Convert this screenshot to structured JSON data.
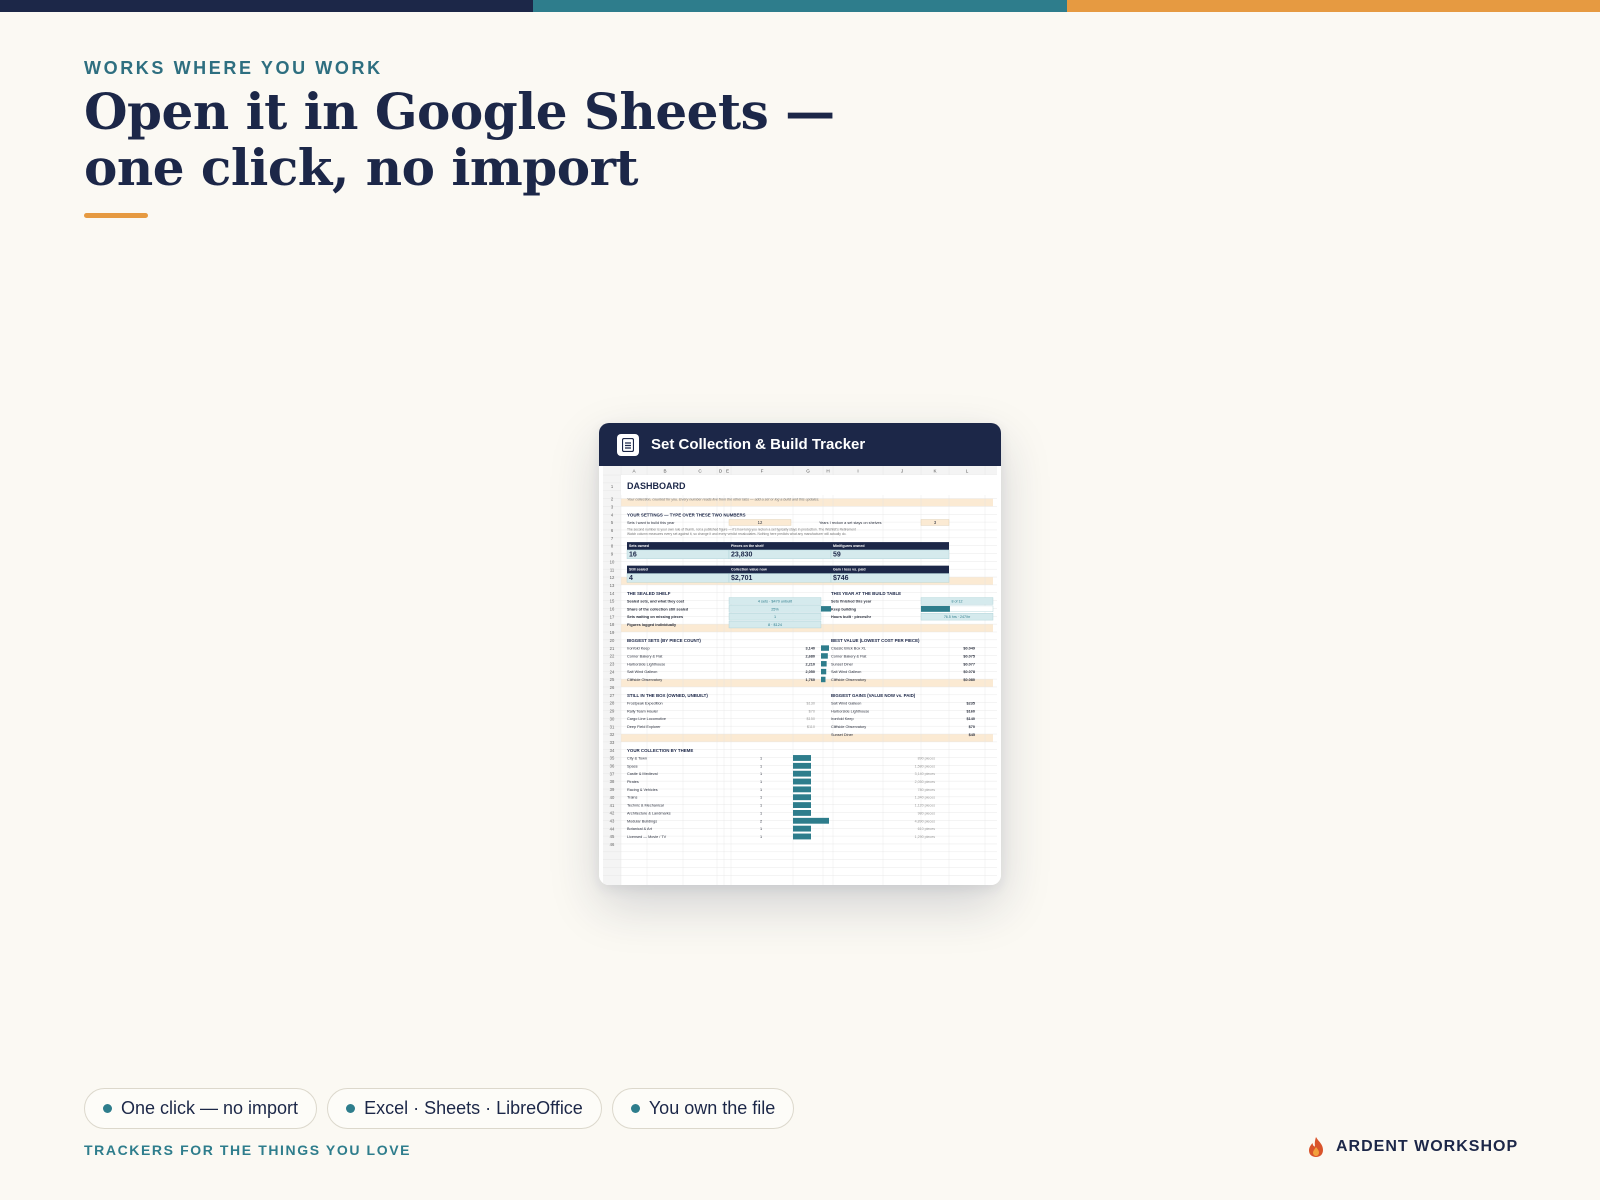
{
  "colors": {
    "navy": "#1c2748",
    "teal": "#2e7d8c",
    "orange": "#e69a41",
    "cream": "#fbf9f3"
  },
  "eyebrow": "WORKS WHERE YOU WORK",
  "headline": {
    "line1": "Open it in Google Sheets —",
    "line2": "one click, no import"
  },
  "preview": {
    "title": "Set Collection & Build Tracker",
    "icon": "sheet-icon",
    "columns": [
      "A",
      "B",
      "C",
      "D",
      "E",
      "F",
      "G",
      "H",
      "I",
      "J",
      "K",
      "L"
    ],
    "dashboard_title": "DASHBOARD",
    "intro": "Your collection, counted for you. Every number reads live from the other tabs — add a set or log a build and this updates.",
    "settings_header": "YOUR SETTINGS — TYPE OVER THESE TWO NUMBERS",
    "settings": [
      {
        "label": "Sets I want to build this year",
        "value": "12"
      },
      {
        "label": "Years I reckon a set stays on shelves",
        "value": "3"
      }
    ],
    "settings_note": "The second number is your own rule of thumb, not a published figure — it's how long you reckon a set typically stays in production. The Wishlist's Retirement Watch column measures every set against it, so change it and every verdict recalculates. Nothing here predicts what any manufacturer will actually do.",
    "kpis_row1": [
      {
        "label": "Sets owned",
        "value": "16"
      },
      {
        "label": "Pieces on the shelf",
        "value": "23,830"
      },
      {
        "label": "Minifigures owned",
        "value": "59"
      }
    ],
    "kpis_row2": [
      {
        "label": "Still sealed",
        "value": "4"
      },
      {
        "label": "Collection value now",
        "value": "$2,701"
      },
      {
        "label": "Gain / loss vs. paid",
        "value": "$746"
      }
    ],
    "sealed_header": "THE SEALED SHELF",
    "sealed": [
      {
        "label": "Sealed sets, and what they cost",
        "value": "4 sets · $470 unbuilt"
      },
      {
        "label": "Share of the collection still sealed",
        "value": "25%",
        "fraction": 0.25
      },
      {
        "label": "Sets waiting on missing pieces",
        "value": "1"
      },
      {
        "label": "Figures logged individually",
        "value": "8 · $124"
      }
    ],
    "build_header": "THIS YEAR AT THE BUILD TABLE",
    "build": [
      {
        "label": "Sets finished this year",
        "value": "8 of 12"
      },
      {
        "label": "Keep building",
        "value": "",
        "fraction": 0.67
      },
      {
        "label": "Hours built · pieces/hr",
        "value": "76.5 hrs · 247/hr"
      }
    ],
    "biggest_header": "BIGGEST SETS (BY PIECE COUNT)",
    "biggest": [
      {
        "name": "Ironfold Keep",
        "value": "3,140"
      },
      {
        "name": "Corner Bakery & Flat",
        "value": "2,680"
      },
      {
        "name": "Harborside Lighthouse",
        "value": "2,210"
      },
      {
        "name": "Salt Wind Galleon",
        "value": "2,050"
      },
      {
        "name": "Cliffside Observatory",
        "value": "1,760"
      }
    ],
    "bestvalue_header": "BEST VALUE (LOWEST COST PER PIECE)",
    "bestvalue": [
      {
        "name": "Classic Brick Box XL",
        "value": "$0.049"
      },
      {
        "name": "Corner Bakery & Flat",
        "value": "$0.075"
      },
      {
        "name": "Sunset Diner",
        "value": "$0.077"
      },
      {
        "name": "Salt Wind Galleon",
        "value": "$0.078"
      },
      {
        "name": "Cliffside Observatory",
        "value": "$0.080"
      }
    ],
    "inbox_header": "STILL IN THE BOX (OWNED, UNBUILT)",
    "inbox": [
      {
        "name": "Frostpeak Expedition",
        "value": "$130"
      },
      {
        "name": "Rally Team Hauler",
        "value": "$70"
      },
      {
        "name": "Cargo Line Locomotive",
        "value": "$150"
      },
      {
        "name": "Deep Field Explorer",
        "value": "$110"
      }
    ],
    "gains_header": "BIGGEST GAINS (VALUE NOW vs. PAID)",
    "gains": [
      {
        "name": "Salt Wind Galleon",
        "value": "$235"
      },
      {
        "name": "Harborside Lighthouse",
        "value": "$160"
      },
      {
        "name": "Ironfold Keep",
        "value": "$140"
      },
      {
        "name": "Cliffside Observatory",
        "value": "$70"
      },
      {
        "name": "Sunset Diner",
        "value": "$45"
      }
    ],
    "theme_header": "YOUR COLLECTION BY THEME",
    "themes": [
      {
        "name": "City & Town",
        "count": 1,
        "pieces": "890 pieces"
      },
      {
        "name": "Space",
        "count": 1,
        "pieces": "1,580 pieces"
      },
      {
        "name": "Castle & Medieval",
        "count": 1,
        "pieces": "3,140 pieces"
      },
      {
        "name": "Pirates",
        "count": 1,
        "pieces": "2,050 pieces"
      },
      {
        "name": "Racing & Vehicles",
        "count": 1,
        "pieces": "780 pieces"
      },
      {
        "name": "Trains",
        "count": 1,
        "pieces": "1,340 pieces"
      },
      {
        "name": "Technic & Mechanical",
        "count": 1,
        "pieces": "1,120 pieces"
      },
      {
        "name": "Architecture & Landmarks",
        "count": 1,
        "pieces": "980 pieces"
      },
      {
        "name": "Modular Buildings",
        "count": 2,
        "pieces": "4,890 pieces"
      },
      {
        "name": "Botanical & Art",
        "count": 1,
        "pieces": "610 pieces"
      },
      {
        "name": "Licensed — Movie / TV",
        "count": 1,
        "pieces": "1,290 pieces"
      }
    ]
  },
  "pills": [
    "One click — no import",
    "Excel · Sheets · LibreOffice",
    "You own the file"
  ],
  "footer_tag": "TRACKERS FOR THE THINGS YOU LOVE",
  "brand": {
    "name": "ARDENT WORKSHOP",
    "icon": "flame-icon"
  }
}
